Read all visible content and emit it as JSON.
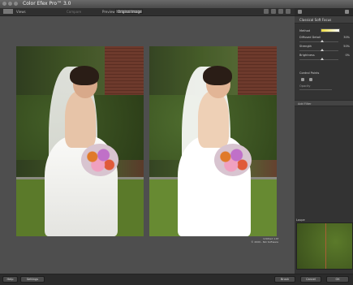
{
  "window": {
    "title": "Color Efex Pro™ 3.0"
  },
  "toolbar": {
    "views_label": "Views",
    "compare_label": "Compare",
    "preview_label": "Preview",
    "bg_label": "Original Image"
  },
  "canvas": {
    "photo_caption_line1": "Untitled 1.tif",
    "photo_caption_line2": "© 2009 - Nik Software"
  },
  "sidebar": {
    "filter_title": "Classical Soft Focus",
    "method_label": "Method",
    "diffused_label": "Diffused Detail",
    "diffused_value": "30%",
    "strength_label": "Strength",
    "strength_value": "50%",
    "brightness_label": "Brightness",
    "brightness_value": "0%",
    "control_points_label": "Control Points",
    "control_points_sub": "Opacity",
    "add_filter_label": "Add Filter",
    "loupe_label": "Loupe"
  },
  "bottombar": {
    "help_label": "Help",
    "settings_label": "Settings",
    "brush_label": "Brush",
    "cancel_label": "Cancel",
    "ok_label": "OK"
  }
}
